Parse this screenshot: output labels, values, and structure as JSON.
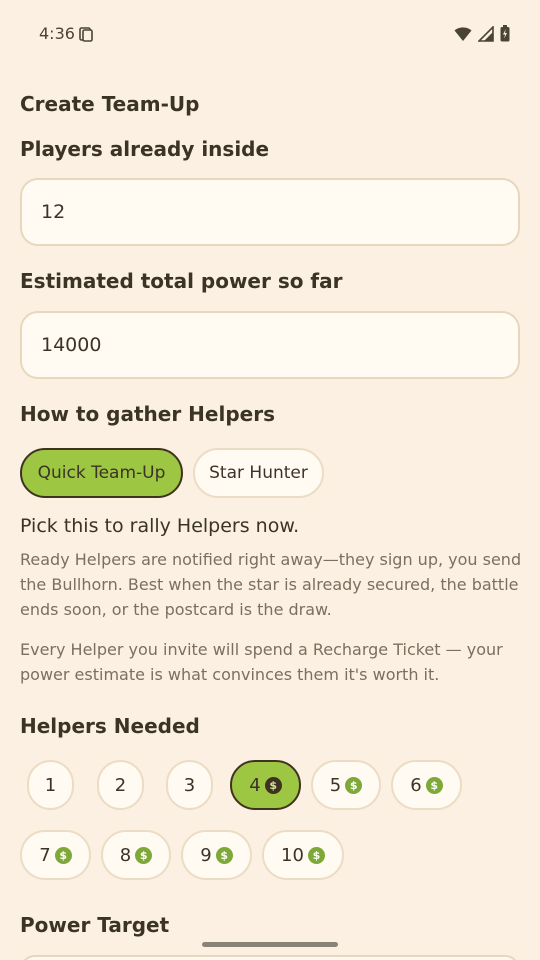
{
  "status_bar": {
    "time": "4:36"
  },
  "title": "Create Team-Up",
  "players": {
    "label": "Players already inside",
    "value": "12"
  },
  "power": {
    "label": "Estimated total power so far",
    "value": "14000"
  },
  "gather": {
    "label": "How to gather Helpers",
    "options": [
      "Quick Team-Up",
      "Star Hunter"
    ],
    "selected": "Quick Team-Up"
  },
  "description": {
    "heading": "Pick this to rally Helpers now.",
    "paragraph1": "Ready Helpers are notified right away—they sign up, you send the Bullhorn. Best when the star is already secured, the battle ends soon, or the postcard is the draw.",
    "paragraph2": "Every Helper you invite will spend a Recharge Ticket — your power estimate is what convinces them it's worth it."
  },
  "helpers_needed": {
    "label": "Helpers Needed",
    "options": [
      "1",
      "2",
      "3",
      "4",
      "5",
      "6",
      "7",
      "8",
      "9",
      "10"
    ],
    "selected": "4",
    "coin_symbol": "$"
  },
  "power_target": {
    "label": "Power Target"
  },
  "colors": {
    "background": "#fbf0e1",
    "accent": "#9dc642",
    "coin": "#7ea838",
    "field_border": "#e8d7bd"
  }
}
